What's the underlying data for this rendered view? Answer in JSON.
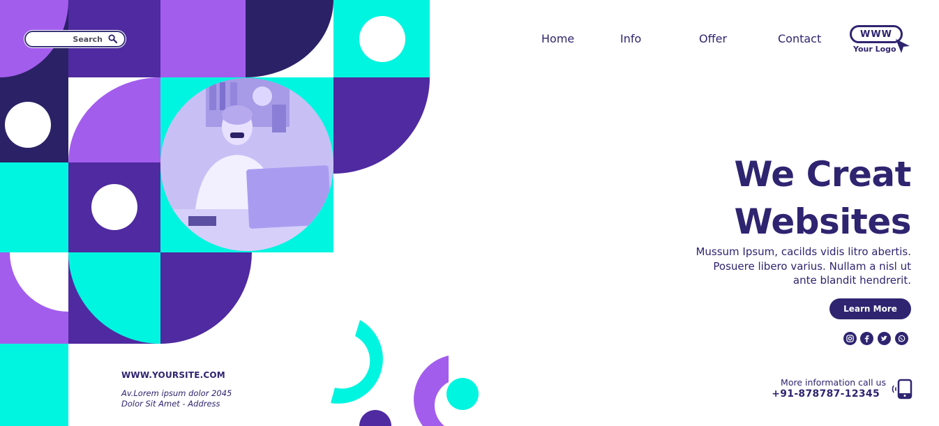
{
  "search": {
    "label": "Search",
    "icon": "search-icon"
  },
  "nav": {
    "items": [
      "Home",
      "Info",
      "Offer",
      "Contact"
    ]
  },
  "logo": {
    "www": "WWW",
    "text": "Your Logo",
    "icon": "cursor-arrow-icon"
  },
  "hero": {
    "title_line1": "We Creat",
    "title_line2": "Websites",
    "text_line1": "Mussum Ipsum, cacilds vidis litro abertis.",
    "text_line2": "Posuere libero varius. Nullam a nisl ut",
    "text_line3": "ante blandit hendrerit.",
    "button": "Learn More"
  },
  "social": [
    "instagram-icon",
    "facebook-icon",
    "twitter-icon",
    "whatsapp-icon"
  ],
  "footer": {
    "site": "WWW.YOURSITE.COM",
    "address_line1": "Av.Lorem ipsum dolor 2045",
    "address_line2": "Dolor Sit Amet - Address",
    "call_label": "More information call us",
    "phone": "+91-878787-12345",
    "phone_icon": "phone-icon"
  },
  "colors": {
    "dark": "#2e2470",
    "purple": "#4f2aa0",
    "violet": "#a35ded",
    "cyan": "#00f5e0",
    "deep": "#2b2166"
  }
}
